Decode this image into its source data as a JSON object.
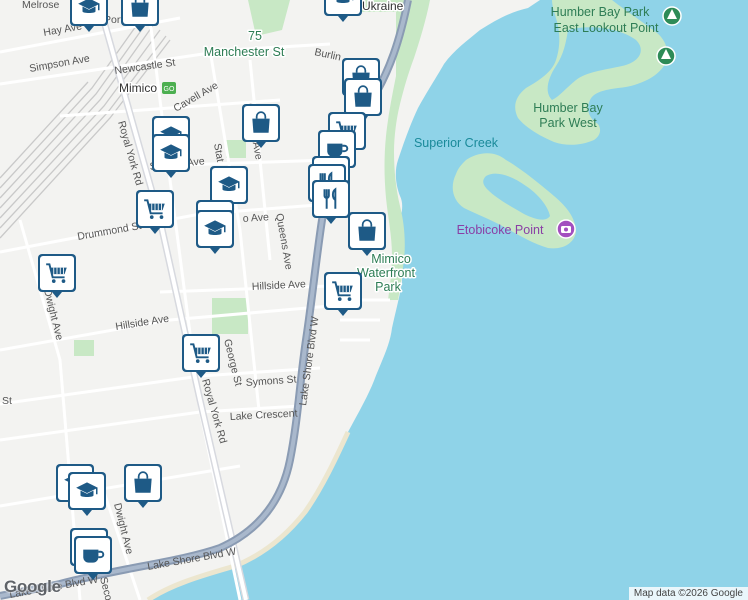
{
  "map": {
    "labels": {
      "manchester_number": "75",
      "manchester": "Manchester St",
      "ukraine": "of Ukraine",
      "humber_east_1": "Humber Bay Park",
      "humber_east_2": "East Lookout Point",
      "humber_west_1": "Humber Bay",
      "humber_west_2": "Park West",
      "superior_creek": "Superior Creek",
      "etobicoke_point": "Etobicoke Point",
      "mimico_wf_1": "Mimico",
      "mimico_wf_2": "Waterfront",
      "mimico_wf_3": "Park",
      "mimico_station": "Mimico"
    },
    "streets": {
      "melrose": "Melrose",
      "hay": "Hay Ave",
      "portland": "Port",
      "simpson": "Simpson Ave",
      "newcastle": "Newcastle St",
      "burlington": "Burlin",
      "cavell": "Cavell Ave",
      "stanley": "Stanley Ave",
      "station": "Stat",
      "queens_upper": "Queens Ave",
      "queens_lower": "Queens Ave",
      "drummond": "Drummond St",
      "mimico_ave": "o Ave",
      "hillside_e": "Hillside Ave",
      "hillside_w": "Hillside Ave",
      "dwight_upper": "Dwight Ave",
      "dwight_lower": "Dwight Ave",
      "george": "George St",
      "symons": "Symons St",
      "lake_crescent": "Lake Crescent",
      "st_left": "St",
      "royal_york_upper": "Royal York Rd",
      "royal_york_lower": "Royal York Rd",
      "lake_shore_n": "Lake Shore Blvd W",
      "lake_shore_s": "Lake Shore Blvd W",
      "lake_shore_w": "Lake Shore Blvd W",
      "second": "Secon",
      "gov": "G"
    },
    "attribution": "Map data ©2026 Google",
    "google": "Google",
    "colors": {
      "water": "#8fd3e8",
      "land": "#f3f3f1",
      "park": "#c8e8c5",
      "highway": "#8a9bb3",
      "pin_fill": "#1e5a86",
      "pin_bg": "#ffffff",
      "rail": "#c9c9c9"
    },
    "markers": [
      {
        "icon": "school-icon",
        "name": "school-marker"
      },
      {
        "icon": "shopping-bag-icon",
        "name": "shop-marker"
      },
      {
        "icon": "grocery-cart-icon",
        "name": "grocery-marker"
      },
      {
        "icon": "restaurant-icon",
        "name": "restaurant-marker"
      },
      {
        "icon": "cafe-icon",
        "name": "cafe-marker"
      },
      {
        "icon": "parking-icon",
        "name": "parking-marker"
      }
    ]
  }
}
